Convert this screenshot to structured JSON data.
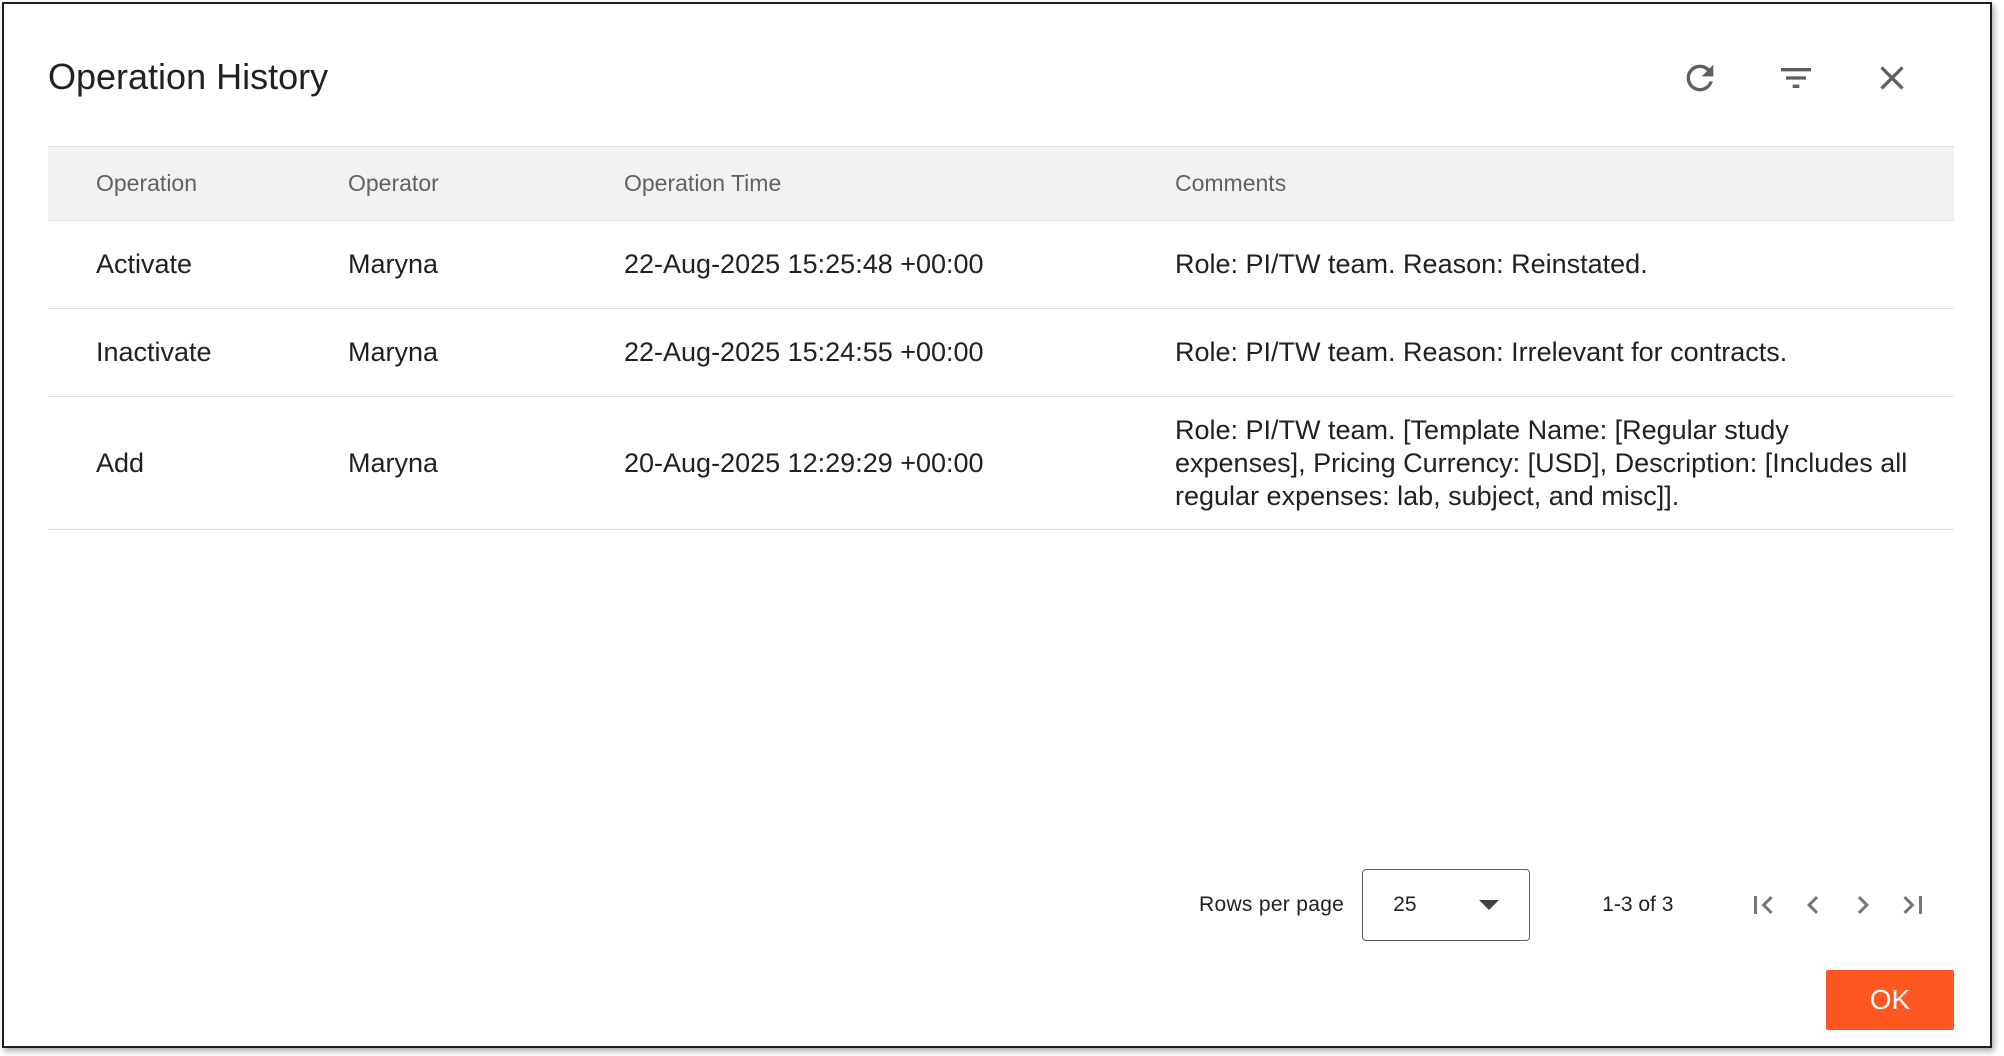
{
  "dialog": {
    "title": "Operation History",
    "icons": [
      "refresh-icon",
      "filter-icon",
      "close-icon"
    ]
  },
  "table": {
    "headers": [
      "Operation",
      "Operator",
      "Operation Time",
      "Comments"
    ],
    "rows": [
      [
        "Activate",
        "Maryna",
        "22-Aug-2025 15:25:48 +00:00",
        "Role: PI/TW team. Reason: Reinstated."
      ],
      [
        "Inactivate",
        "Maryna",
        "22-Aug-2025 15:24:55 +00:00",
        "Role: PI/TW team. Reason: Irrelevant for contracts."
      ],
      [
        "Add",
        "Maryna",
        "20-Aug-2025 12:29:29 +00:00",
        "Role: PI/TW team. [Template Name: [Regular study expenses], Pricing Currency: [USD], Description: [Includes all regular expenses: lab, subject, and misc]]."
      ]
    ]
  },
  "pagination": {
    "rows_per_page_label": "Rows per page",
    "rows_per_page_value": "25",
    "range_text": "1-3 of 3",
    "icons": [
      "first-page-icon",
      "prev-page-icon",
      "next-page-icon",
      "last-page-icon"
    ]
  },
  "footer": {
    "ok_label": "OK"
  },
  "colors": {
    "accent": "#ff5722",
    "header_bg": "#f2f2f2",
    "text": "#212121",
    "muted": "#616161"
  }
}
